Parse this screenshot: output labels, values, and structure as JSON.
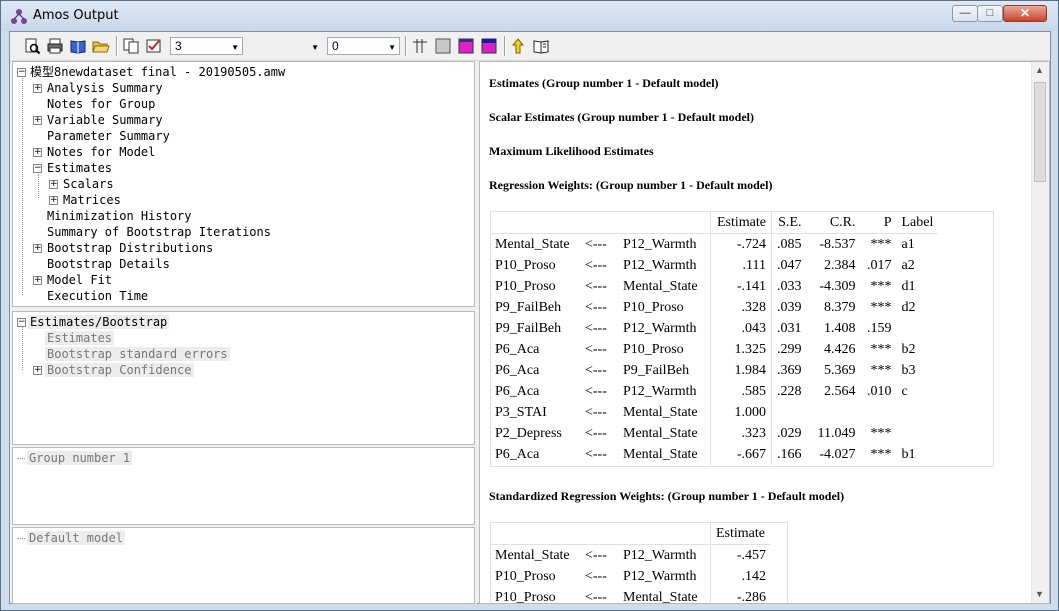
{
  "window": {
    "title": "Amos Output"
  },
  "toolbar": {
    "combo1_value": "3",
    "combo2_value": "0"
  },
  "tree": {
    "root": "模型8newdataset final - 20190505.amw",
    "items": [
      "Analysis Summary",
      "Notes for Group",
      "Variable Summary",
      "Parameter Summary",
      "Notes for Model",
      "Estimates",
      "Scalars",
      "Matrices",
      "Minimization History",
      "Summary of Bootstrap Iterations",
      "Bootstrap Distributions",
      "Bootstrap Details",
      "Model Fit",
      "Execution Time"
    ]
  },
  "pane2": {
    "root": "Estimates/Bootstrap",
    "items": [
      "Estimates",
      "Bootstrap standard errors",
      "Bootstrap Confidence"
    ]
  },
  "pane3": {
    "label": "Group number 1"
  },
  "pane4": {
    "label": "Default model"
  },
  "output": {
    "h1": "Estimates (Group number 1 - Default model)",
    "h2": "Scalar Estimates (Group number 1 - Default model)",
    "h3": "Maximum Likelihood Estimates",
    "h4": "Regression Weights: (Group number 1 - Default model)",
    "reg_headers": [
      "",
      "",
      "",
      "Estimate",
      "S.E.",
      "C.R.",
      "P",
      "Label"
    ],
    "reg_rows": [
      [
        "Mental_State",
        "<---",
        "P12_Warmth",
        "-.724",
        ".085",
        "-8.537",
        "***",
        "a1"
      ],
      [
        "P10_Proso",
        "<---",
        "P12_Warmth",
        ".111",
        ".047",
        "2.384",
        ".017",
        "a2"
      ],
      [
        "P10_Proso",
        "<---",
        "Mental_State",
        "-.141",
        ".033",
        "-4.309",
        "***",
        "d1"
      ],
      [
        "P9_FailBeh",
        "<---",
        "P10_Proso",
        ".328",
        ".039",
        "8.379",
        "***",
        "d2"
      ],
      [
        "P9_FailBeh",
        "<---",
        "P12_Warmth",
        ".043",
        ".031",
        "1.408",
        ".159",
        ""
      ],
      [
        "P6_Aca",
        "<---",
        "P10_Proso",
        "1.325",
        ".299",
        "4.426",
        "***",
        "b2"
      ],
      [
        "P6_Aca",
        "<---",
        "P9_FailBeh",
        "1.984",
        ".369",
        "5.369",
        "***",
        "b3"
      ],
      [
        "P6_Aca",
        "<---",
        "P12_Warmth",
        ".585",
        ".228",
        "2.564",
        ".010",
        "c"
      ],
      [
        "P3_STAI",
        "<---",
        "Mental_State",
        "1.000",
        "",
        "",
        "",
        ""
      ],
      [
        "P2_Depress",
        "<---",
        "Mental_State",
        ".323",
        ".029",
        "11.049",
        "***",
        ""
      ],
      [
        "P6_Aca",
        "<---",
        "Mental_State",
        "-.667",
        ".166",
        "-4.027",
        "***",
        "b1"
      ]
    ],
    "h5": "Standardized Regression Weights: (Group number 1 - Default model)",
    "std_headers": [
      "",
      "",
      "",
      "Estimate"
    ],
    "std_rows": [
      [
        "Mental_State",
        "<---",
        "P12_Warmth",
        "-.457"
      ],
      [
        "P10_Proso",
        "<---",
        "P12_Warmth",
        ".142"
      ],
      [
        "P10_Proso",
        "<---",
        "Mental_State",
        "-.286"
      ]
    ]
  }
}
